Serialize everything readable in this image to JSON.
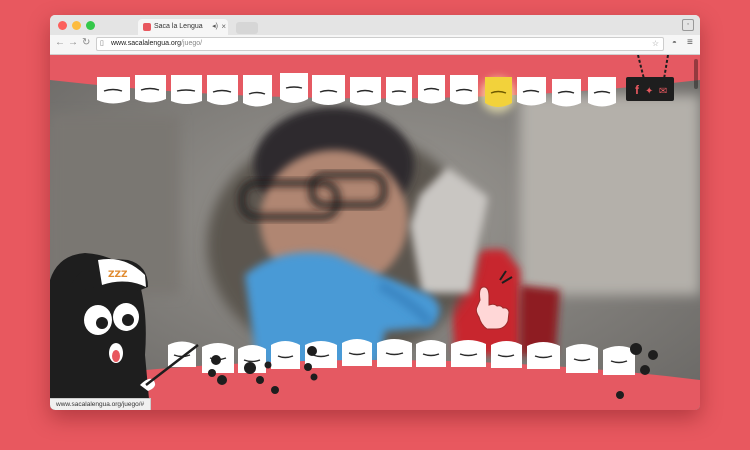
{
  "browser": {
    "tab_title": "Saca la Lengua",
    "url_domain": "www.sacalalengua.org",
    "url_path": "/juego/",
    "status_url": "www.sacalalengua.org/juego/#"
  },
  "game": {
    "mascot_cap_text": "ZZZ",
    "social": [
      "facebook",
      "twitter",
      "email"
    ]
  },
  "colors": {
    "brand": "#e8585f",
    "gum": "#e55962",
    "tooth": "#ffffff",
    "tooth_highlight": "#f2d23b",
    "bacteria": "#1e1e1e",
    "glove": "#4a9ad6"
  }
}
